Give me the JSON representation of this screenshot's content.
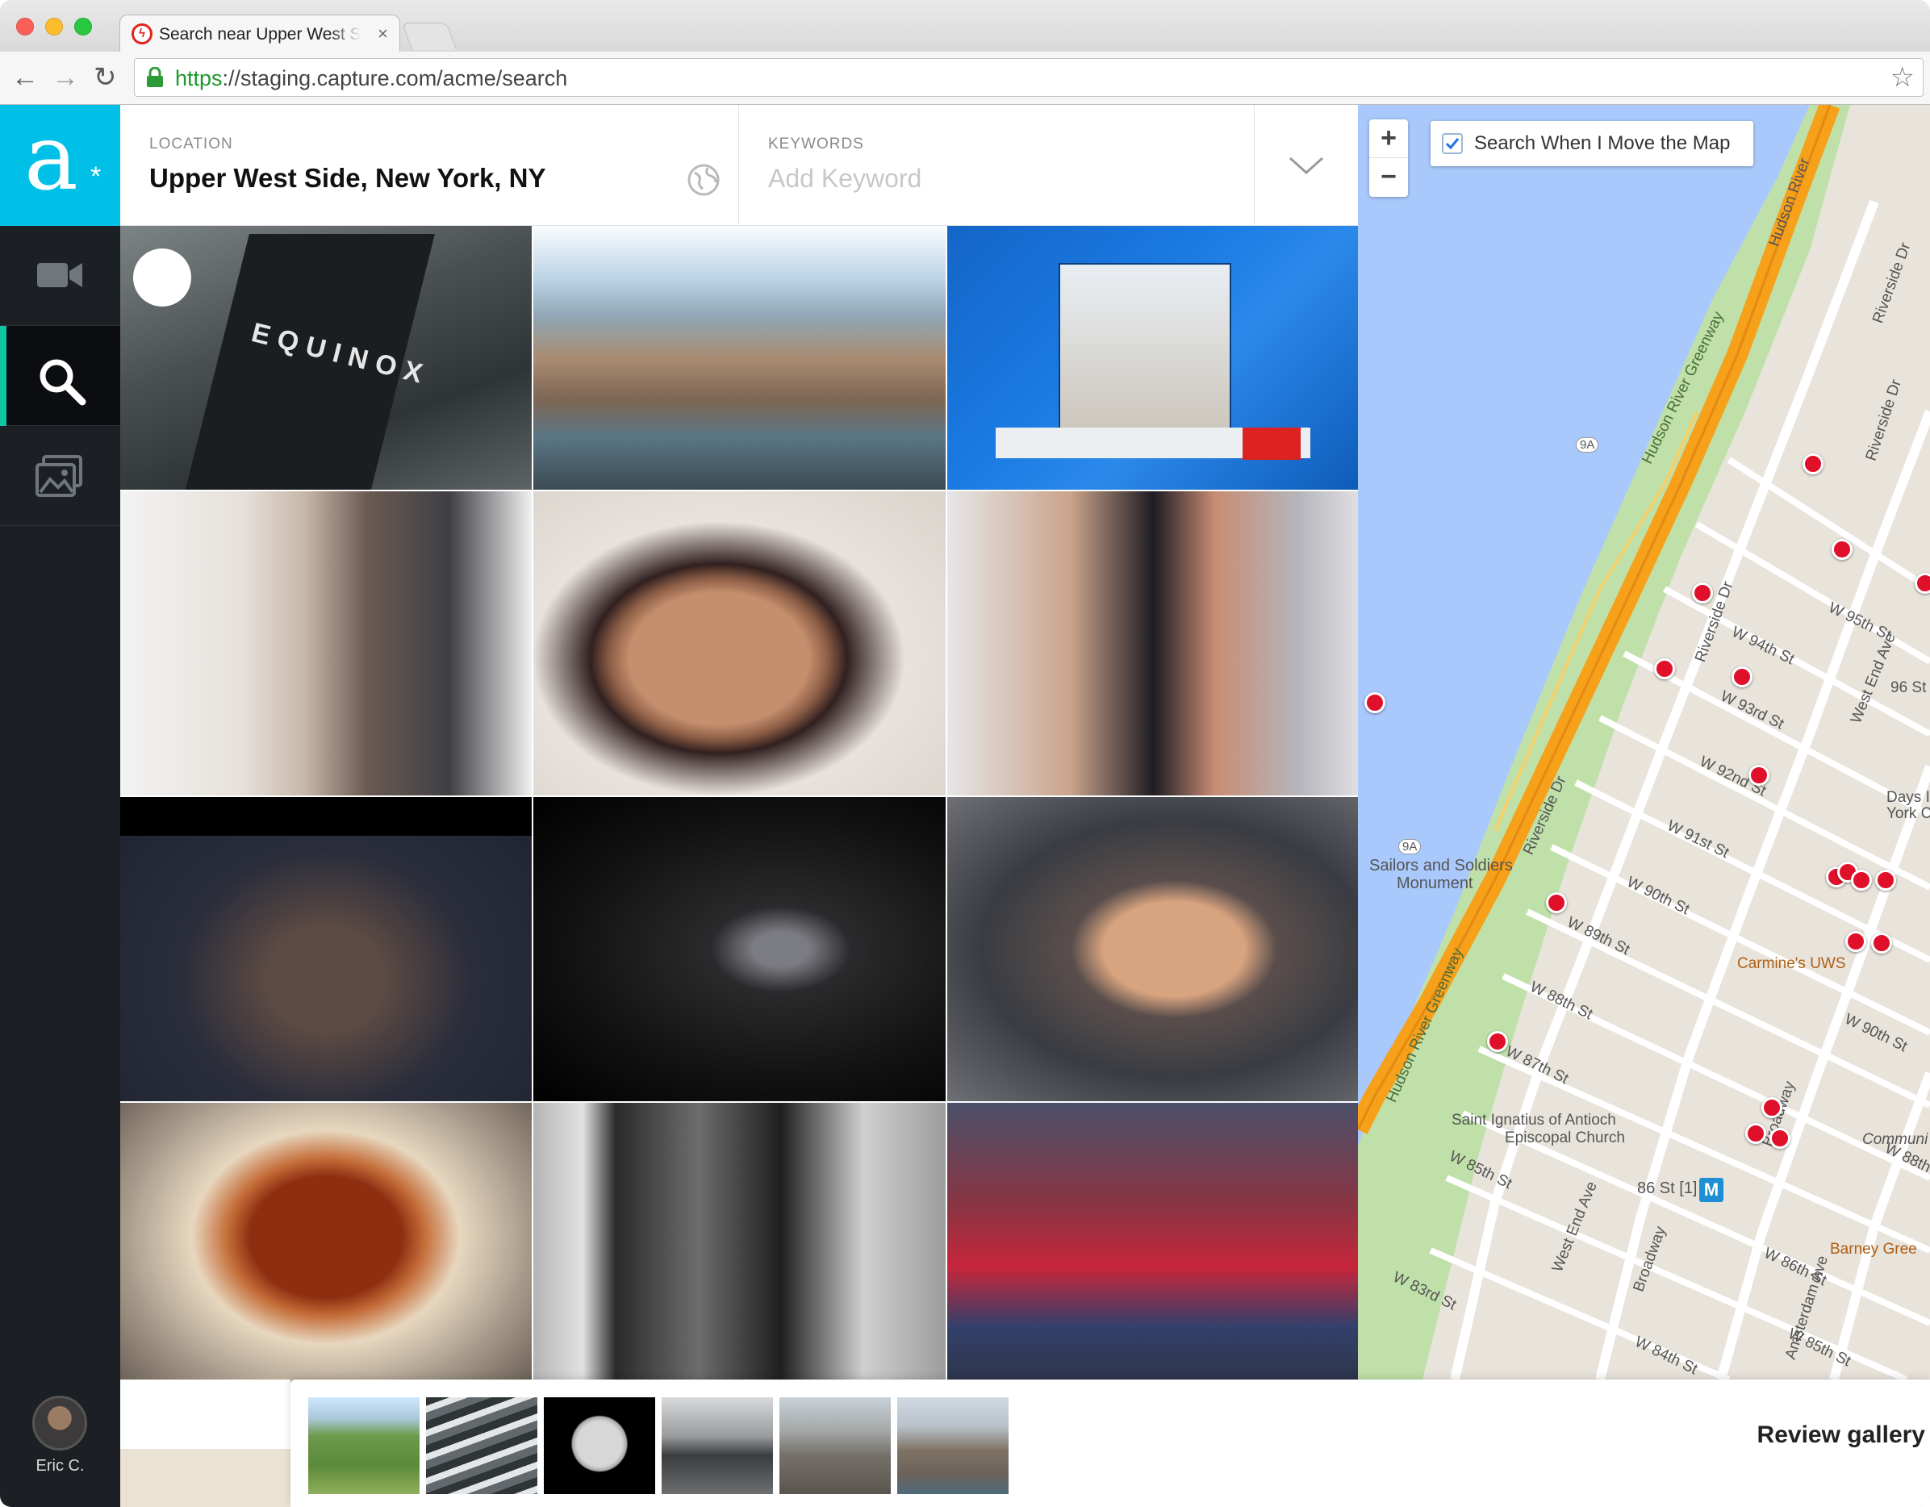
{
  "browser": {
    "tab_title": "Search near Upper West Side",
    "url_scheme": "https",
    "url_rest": "://staging.capture.com/acme/search"
  },
  "sidebar": {
    "logo_letter": "a",
    "logo_mark": "*",
    "items": [
      {
        "icon": "video-camera-icon"
      },
      {
        "icon": "search-icon",
        "active": true
      },
      {
        "icon": "photo-gallery-icon"
      }
    ],
    "user_name": "Eric C."
  },
  "search": {
    "location_label": "LOCATION",
    "location_value": "Upper West Side, New York, NY",
    "keywords_label": "KEYWORDS",
    "keywords_placeholder": "Add Keyword",
    "keywords_value": ""
  },
  "map": {
    "zoom_in": "+",
    "zoom_out": "−",
    "search_on_move_label": "Search When I Move the Map",
    "search_on_move_checked": true,
    "streets": [
      "W 95th St",
      "W 94th St",
      "W 93rd St",
      "W 92nd St",
      "W 91st St",
      "W 90th St",
      "W 89th St",
      "W 88th St",
      "W 87th St",
      "W 85th St",
      "W 83rd St",
      "W 84th St",
      "W 86th St",
      "W 88th St",
      "W 90th St",
      "W 85th St",
      "96 St"
    ],
    "avenues": [
      "Riverside Dr",
      "Riverside Dr",
      "Riverside Dr",
      "Riverside Dr",
      "West End Ave",
      "West End Ave",
      "Broadway",
      "Broadway",
      "Amsterdam Ave",
      "Hudson River Greenway",
      "Hudson River Greenway",
      "Hudson River",
      "9A",
      "9A"
    ],
    "poi": [
      "Sailors and Soldiers",
      "Monument",
      "Carmine's UWS",
      "Saint Ignatius of Antioch",
      "Episcopal Church",
      "Days Inn",
      "York City",
      "Barney Gree",
      "Communi"
    ],
    "subway_station": "86 St [1]",
    "subway_badge": "M"
  },
  "tray": {
    "thumbnails": [
      "mountain-hills",
      "ocean-waves",
      "moon",
      "foggy-valley",
      "hiker-cliff",
      "coastal-cliffs"
    ],
    "review_label": "Review gallery"
  },
  "colors": {
    "accent": "#00c0e8",
    "active_indicator": "#0fc6a2",
    "sidebar": "#1c2024",
    "pin": "#e0102a",
    "water": "#a9c8fb",
    "highway": "#f7a01a",
    "park": "#bfe0a8"
  }
}
